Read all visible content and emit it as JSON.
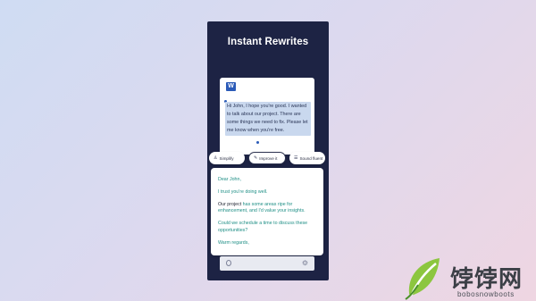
{
  "header": {
    "title": "Instant Rewrites"
  },
  "document": {
    "app_icon": "word-icon",
    "app_icon_letter": "W",
    "selected_text": "Hi John, I hope you're good. I wanted to talk about our project. There are some things we need to fix. Please let me know when you're free."
  },
  "toolbar": {
    "chips": [
      {
        "label": "Simplify",
        "icon": "person-icon"
      },
      {
        "label": "Improve it",
        "icon": "pen-icon"
      },
      {
        "label": "Sound fluent",
        "icon": "list-icon"
      }
    ]
  },
  "rewrite": {
    "greeting": "Dear John,",
    "line1": "I trust you're doing well.",
    "line2_start": "Our project",
    "line2_rest": " has some areas ripe for enhancement, and I'd value your insights.",
    "line3": "Could we schedule a time to discuss these opportunities?",
    "closing": "Warm regards,"
  },
  "input_bar": {
    "left_icon": "mic-icon",
    "right_icon": "gear-icon"
  },
  "watermark": {
    "text": "饽饽网",
    "subtext": "bobosnowboots"
  },
  "colors": {
    "phone_bg": "#1d2344",
    "accent_teal": "#1f8f86",
    "selection": "#c9d8ee",
    "word_blue": "#2b5bb8"
  }
}
